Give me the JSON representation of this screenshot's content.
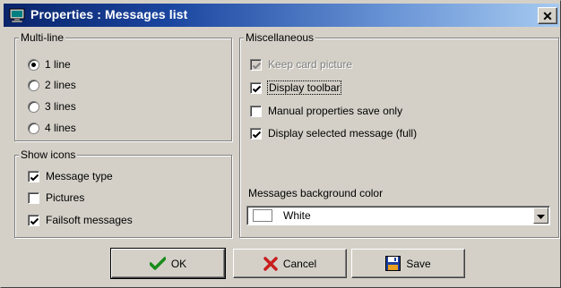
{
  "window": {
    "title": "Properties : Messages list",
    "close_label": "✕"
  },
  "multiline": {
    "legend": "Multi-line",
    "options": [
      {
        "label": "1 line",
        "selected": true
      },
      {
        "label": "2 lines",
        "selected": false
      },
      {
        "label": "3 lines",
        "selected": false
      },
      {
        "label": "4 lines",
        "selected": false
      }
    ]
  },
  "show_icons": {
    "legend": "Show icons",
    "items": [
      {
        "label": "Message type",
        "checked": true
      },
      {
        "label": "Pictures",
        "checked": false
      },
      {
        "label": "Failsoft messages",
        "checked": true
      }
    ]
  },
  "misc": {
    "legend": "Miscellaneous",
    "items": [
      {
        "label": "Keep card picture",
        "checked": true,
        "disabled": true
      },
      {
        "label": "Display toolbar",
        "checked": true,
        "disabled": false
      },
      {
        "label": "Manual properties save only",
        "checked": false,
        "disabled": false
      },
      {
        "label": "Display selected message (full)",
        "checked": true,
        "disabled": false
      }
    ],
    "bg_color_label": "Messages background color",
    "bg_color_value": "White",
    "bg_color_swatch": "#ffffff"
  },
  "buttons": {
    "ok": "OK",
    "cancel": "Cancel",
    "save": "Save"
  },
  "colors": {
    "titlebar_start": "#0a246a",
    "titlebar_end": "#a6caf0",
    "face": "#d4d0c8",
    "ok_check": "#1a8c1a",
    "cancel_x": "#c81e1e"
  }
}
